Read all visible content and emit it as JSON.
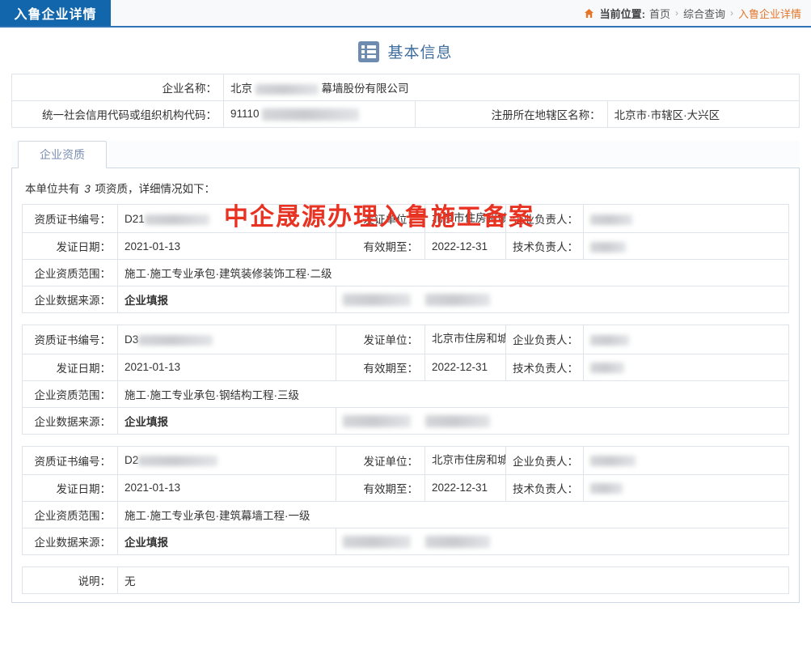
{
  "header": {
    "page_tab": "入鲁企业详情",
    "home_icon": "home-icon",
    "breadcrumb_label": "当前位置:",
    "breadcrumb_items": [
      "首页",
      "综合查询",
      "入鲁企业详情"
    ],
    "separator": "›",
    "accent_blue": "#1266ab",
    "accent_orange": "#e4762a"
  },
  "basic_section": {
    "icon": "list-icon",
    "title": "基本信息",
    "rows": [
      {
        "label": "企业名称：",
        "value_prefix": "北京",
        "value_suffix": "幕墙股份有限公司",
        "redacted": true
      },
      {
        "label": "统一社会信用代码或组织机构代码：",
        "value_prefix": "91110",
        "value_suffix": "",
        "redacted": true
      },
      {
        "label": "注册所在地辖区名称：",
        "value_prefix": "北京市·市辖区·大兴区",
        "value_suffix": "",
        "redacted": false
      }
    ]
  },
  "tab_panel": {
    "tabs": [
      {
        "label": "企业资质",
        "active": true
      }
    ],
    "summary_prefix": "本单位共有",
    "summary_count": "3",
    "summary_suffix": "项资质，详细情况如下："
  },
  "watermark": {
    "text": "中企晟源办理入鲁施工备案",
    "color": "#e83323"
  },
  "labels": {
    "cert_no": "资质证书编号：",
    "issuer": "发证单位：",
    "legal_rep": "企业负责人：",
    "issue_date": "发证日期：",
    "valid_until": "有效期至：",
    "tech_rep": "技术负责人：",
    "scope": "企业资质范围：",
    "source": "企业数据来源："
  },
  "qualifications": [
    {
      "cert_no_prefix": "D21",
      "cert_no_redacted": true,
      "issuer": "北京市住房和城乡建设委员会",
      "legal_rep": "",
      "legal_rep_redacted": true,
      "issue_date": "2021-01-13",
      "valid_until": "2022-12-31",
      "tech_rep": "",
      "tech_rep_redacted": true,
      "scope": "施工·施工专业承包·建筑装修装饰工程·二级",
      "source": "企业填报",
      "source_color": "#d11a0f",
      "extra_redacted": true
    },
    {
      "cert_no_prefix": "D3",
      "cert_no_redacted": true,
      "issuer": "北京市住房和城乡建设委员会",
      "legal_rep": "",
      "legal_rep_redacted": true,
      "issue_date": "2021-01-13",
      "valid_until": "2022-12-31",
      "tech_rep": "",
      "tech_rep_redacted": true,
      "scope": "施工·施工专业承包·钢结构工程·三级",
      "source": "企业填报",
      "source_color": "#d11a0f",
      "extra_redacted": true
    },
    {
      "cert_no_prefix": "D2",
      "cert_no_redacted": true,
      "issuer": "北京市住房和城乡建设委员会",
      "legal_rep": "",
      "legal_rep_redacted": true,
      "issue_date": "2021-01-13",
      "valid_until": "2022-12-31",
      "tech_rep": "",
      "tech_rep_redacted": true,
      "scope": "施工·施工专业承包·建筑幕墙工程·一级",
      "source": "企业填报",
      "source_color": "#d11a0f",
      "extra_redacted": true
    }
  ],
  "note": {
    "label": "说明：",
    "value": "无"
  }
}
